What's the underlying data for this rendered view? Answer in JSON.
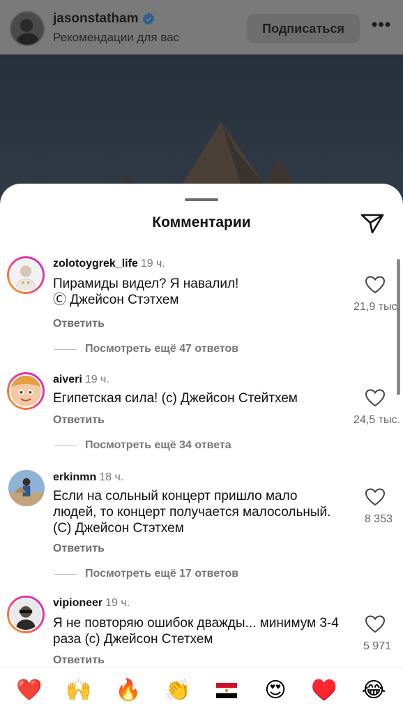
{
  "header": {
    "username": "jasonstatham",
    "subtitle": "Рекомендации для вас",
    "follow_label": "Подписаться",
    "more_label": "•••"
  },
  "sheet": {
    "title": "Комментарии"
  },
  "comments": [
    {
      "username": "zolotoygrek_life",
      "time": "19 ч.",
      "text": "Пирамиды видел? Я навалил!\nⒸ Джейсон Стэтхем",
      "reply_label": "Ответить",
      "likes": "21,9 тыс.",
      "view_more": "Посмотреть ещё 47 ответов"
    },
    {
      "username": "aiveri",
      "time": "19 ч.",
      "text": "Египетская сила! (с) Джейсон Стейтхем",
      "reply_label": "Ответить",
      "likes": "24,5 тыс.",
      "view_more": "Посмотреть ещё 34 ответа"
    },
    {
      "username": "erkinmn",
      "time": "18 ч.",
      "text": "Если на сольный концерт пришло мало людей, то концерт получается малосольный. (С) Джейсон Стэтхем",
      "reply_label": "Ответить",
      "likes": "8 353",
      "view_more": "Посмотреть ещё 17 ответов"
    },
    {
      "username": "vipioneer",
      "time": "19 ч.",
      "text": "Я не повторяю ошибок дважды... минимум 3-4 раза (с) Джейсон Стетхем",
      "reply_label": "Ответить",
      "likes": "5 971"
    }
  ],
  "emoji_bar": [
    "❤️",
    "🙌",
    "🔥",
    "👏",
    "🇪🇬",
    "😍",
    "♥️",
    "😂"
  ],
  "colors": {
    "verified": "#3797f0",
    "heart_red": "#ed1b24",
    "story_ring_start": "#fbb000",
    "story_ring_end": "#c72bd4"
  }
}
